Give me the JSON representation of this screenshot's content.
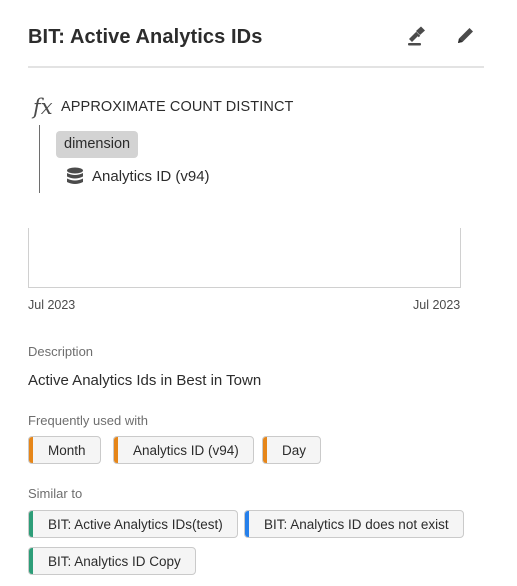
{
  "header": {
    "title": "BIT: Active Analytics IDs",
    "approve_icon": "stamp-approve-icon",
    "edit_icon": "pencil-icon"
  },
  "formula": {
    "function_icon": "fx",
    "function_name": "APPROXIMATE COUNT DISTINCT",
    "param_label": "dimension",
    "dimension_icon": "dimension-stack-icon",
    "dimension_name": "Analytics ID (v94)"
  },
  "trend": {
    "x_start": "Jul 2023",
    "x_end": "Jul 2023"
  },
  "description": {
    "label": "Description",
    "text": "Active Analytics Ids in Best in Town"
  },
  "frequently_used": {
    "label": "Frequently used with",
    "items": [
      {
        "label": "Month",
        "color": "#e68619"
      },
      {
        "label": "Analytics ID (v94)",
        "color": "#e68619"
      },
      {
        "label": "Day",
        "color": "#e68619"
      }
    ]
  },
  "similar": {
    "label": "Similar to",
    "items": [
      {
        "label": "BIT: Active Analytics IDs(test)",
        "color": "#2d9d78"
      },
      {
        "label": "BIT: Analytics ID does not exist",
        "color": "#2680eb"
      },
      {
        "label": "BIT: Analytics ID Copy",
        "color": "#2d9d78"
      }
    ]
  }
}
